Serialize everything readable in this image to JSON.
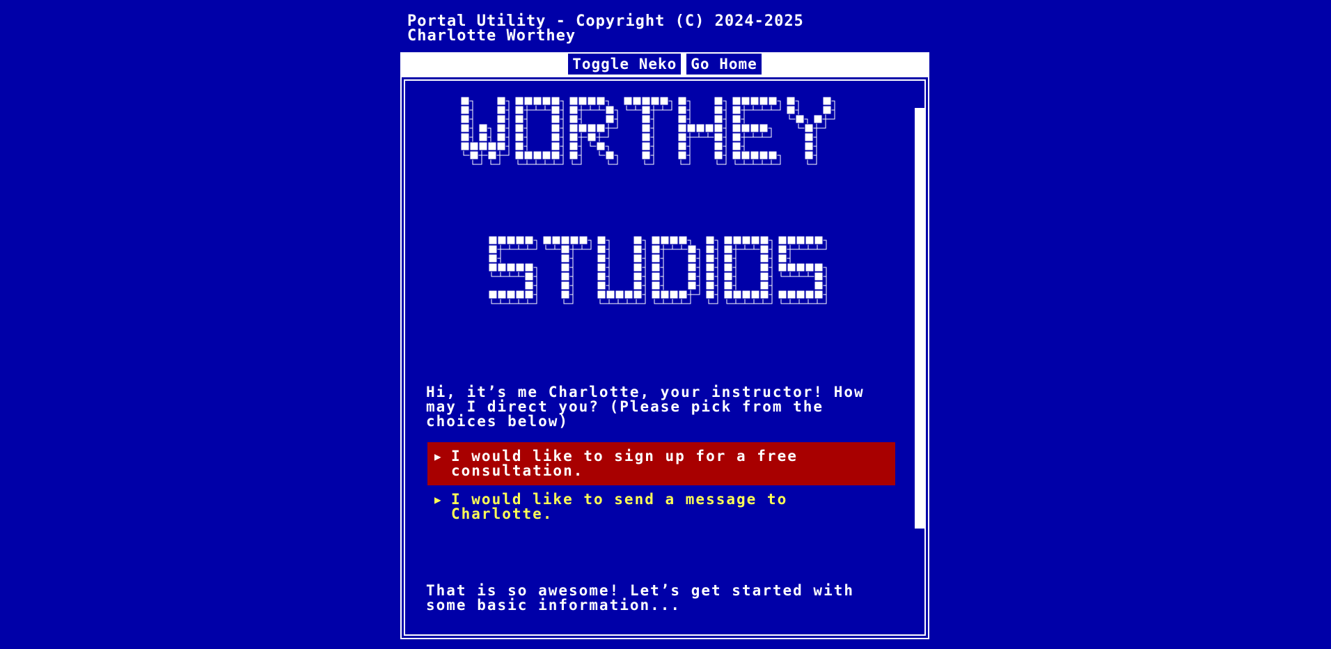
{
  "header": {
    "line1": "Portal Utility - Copyright (C) 2024-2025",
    "line2": "Charlotte Worthey"
  },
  "toolbar": {
    "toggle_neko": "Toggle Neko",
    "go_home": "Go Home"
  },
  "banner": {
    "word1": "WORTHEY",
    "word2": "STUDIOS"
  },
  "intro": {
    "text": "Hi, it’s me Charlotte, your instructor! How may I direct you? (Please pick from the choices below)"
  },
  "choices": [
    {
      "label": "I would like to sign up for a free consultation.",
      "selected": true
    },
    {
      "label": "I would like to send a message to Charlotte.",
      "selected": false
    }
  ],
  "response": {
    "text": "That is so awesome! Let’s get started with some basic information..."
  },
  "colors": {
    "background": "#0000a8",
    "selected_choice": "#a80000",
    "choice_text": "#ffff55"
  }
}
